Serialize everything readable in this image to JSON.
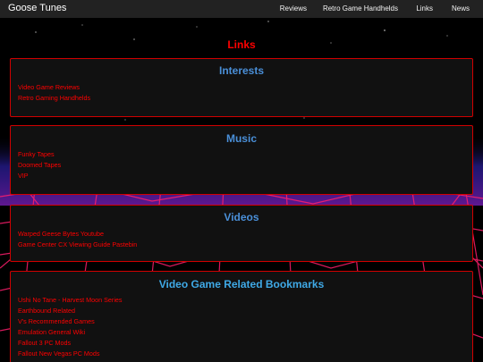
{
  "navbar": {
    "brand": "Goose Tunes",
    "links": [
      "Reviews",
      "Retro Game Handhelds",
      "Links",
      "News"
    ]
  },
  "page": {
    "title": "Links"
  },
  "cards": [
    {
      "title": "Interests",
      "links": [
        "Video Game Reviews",
        "Retro Gaming Handhelds"
      ]
    },
    {
      "title": "Music",
      "links": [
        "Funky Tapes",
        "Doomed Tapes",
        "VIP"
      ]
    },
    {
      "title": "Videos",
      "links": [
        "Warped Geese Bytes Youtube",
        "Game Center CX Viewing Guide Pastebin"
      ]
    },
    {
      "title": "Video Game Related Bookmarks",
      "links": [
        "Ushi No Tane - Harvest Moon Series",
        "Earthbound Related",
        "V's Recommended Games",
        "Emulation General Wiki",
        "Fallout 3 PC Mods",
        "Fallout New Vegas PC Mods"
      ]
    }
  ],
  "colors": {
    "accent": "#ff0000",
    "heading_blue": "#4a8fd8",
    "heading_cyan": "#3fa9e6",
    "card_bg": "#111111",
    "navbar_bg": "#222222"
  }
}
